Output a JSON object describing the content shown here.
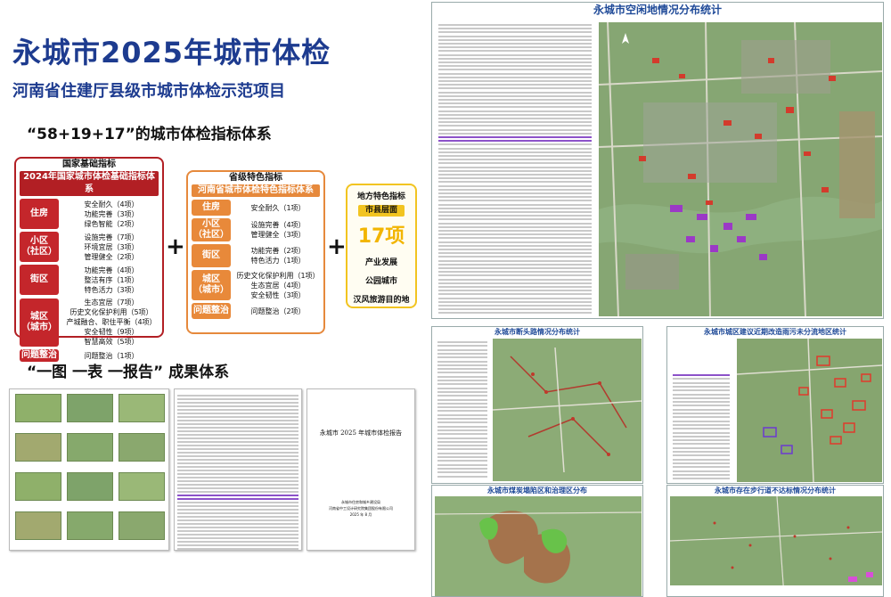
{
  "header": {
    "title": "永城市2025年城市体检",
    "subtitle": "河南省住建厅县级市城市体检示范项目"
  },
  "system": {
    "title": "“58+19+17”的城市体检指标体系",
    "plus": "+",
    "national": {
      "head": "国家基础指标",
      "band": "2024年国家城市体检基础指标体系",
      "rows": [
        {
          "label": "住房",
          "items": [
            "安全耐久（4项）",
            "功能完善（3项）",
            "绿色智能（2项）"
          ]
        },
        {
          "label": "小区\n（社区）",
          "items": [
            "设施完善（7项）",
            "环境宜居（3项）",
            "管理健全（2项）"
          ]
        },
        {
          "label": "街区",
          "items": [
            "功能完善（4项）",
            "整洁有序（1项）",
            "特色活力（3项）"
          ]
        },
        {
          "label": "城区\n（城市）",
          "items": [
            "生态宜居（7项）",
            "历史文化保护利用（5项）",
            "产城融合、职住平衡（4项）",
            "安全韧性（9项）",
            "智慧高效（5项）"
          ]
        },
        {
          "label": "问题整治",
          "items": [
            "问题整治（1项）"
          ]
        }
      ]
    },
    "provincial": {
      "head": "省级特色指标",
      "band": "河南省城市体检特色指标体系",
      "rows": [
        {
          "label": "住房",
          "items": [
            "安全耐久（1项）"
          ]
        },
        {
          "label": "小区\n（社区）",
          "items": [
            "设施完善（4项）",
            "管理健全（3项）"
          ]
        },
        {
          "label": "街区",
          "items": [
            "功能完善（2项）",
            "特色活力（1项）"
          ]
        },
        {
          "label": "城区\n（城市）",
          "items": [
            "历史文化保护利用（1项）",
            "生态宜居（4项）",
            "安全韧性（3项）"
          ]
        },
        {
          "label": "问题整治",
          "items": [
            "问题整治（2项）"
          ]
        }
      ]
    },
    "local": {
      "head": "地方特色指标",
      "band": "市县层面",
      "count": "17项",
      "items": [
        "产业发展",
        "公园城市",
        "汉风旅游目的地"
      ]
    }
  },
  "results": {
    "title": "“一图 一表 一报告” 成果体系",
    "report_title": "永城市 2025 年城市体检报告",
    "report_org1": "永城市住房和城乡建设局",
    "report_org2": "河南省中工设计研究院集团股份有限公司",
    "report_date": "2025 年 8 月"
  },
  "posters": {
    "big_title": "永城市空闲地情况分布统计",
    "p1": "永城市断头路情况分布统计",
    "p2": "永城市城区建议近期改造雨污未分流地区统计",
    "p3": "永城市煤炭塌陷区和治理区分布",
    "p4": "永城市存在步行道不达标情况分布统计"
  },
  "colors": {
    "navy": "#1d3b8f",
    "national_red": "#b21f24",
    "provincial_orange": "#e6893c",
    "local_yellow": "#f2c420"
  }
}
